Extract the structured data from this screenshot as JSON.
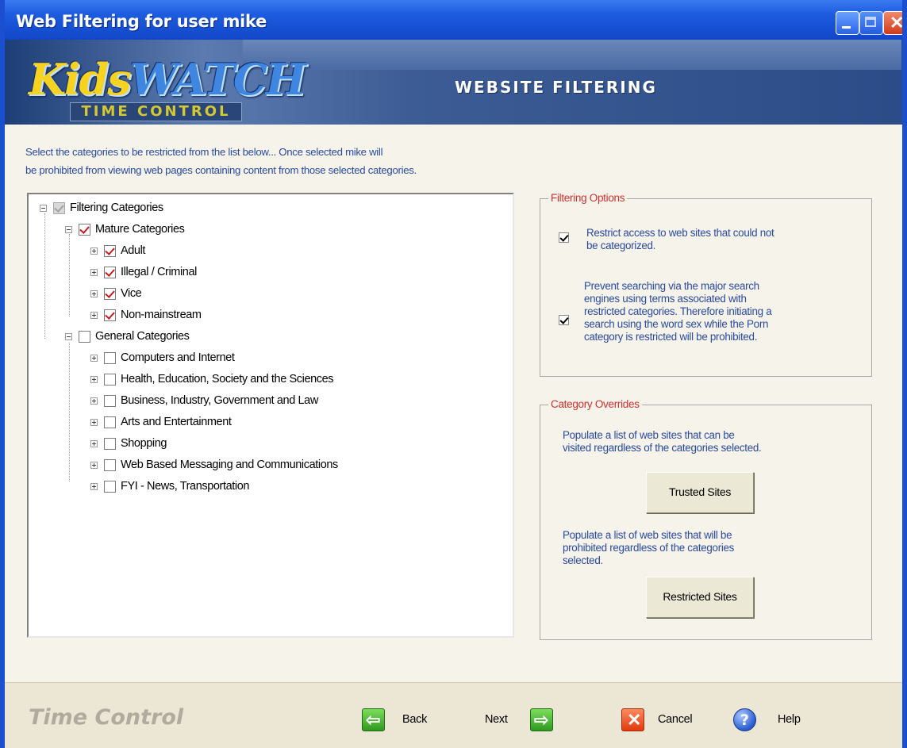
{
  "window": {
    "title": "Web Filtering for user mike"
  },
  "banner": {
    "logo_kids": "Kids",
    "logo_watch": "WATCH",
    "logo_sub": "TIME CONTROL",
    "title": "WEBSITE FILTERING"
  },
  "intro": {
    "line1": "Select the categories to be restricted from the list below... Once selected mike will",
    "line2": "be prohibited from viewing web pages containing content from those selected categories."
  },
  "tree": {
    "root": {
      "label": "Filtering Categories",
      "state": "partial"
    },
    "mature": {
      "label": "Mature Categories",
      "checked": true
    },
    "mature_items": [
      {
        "label": "Adult",
        "checked": true
      },
      {
        "label": "Illegal / Criminal",
        "checked": true
      },
      {
        "label": "Vice",
        "checked": true
      },
      {
        "label": "Non-mainstream",
        "checked": true
      }
    ],
    "general": {
      "label": "General Categories",
      "checked": false
    },
    "general_items": [
      {
        "label": "Computers and Internet",
        "checked": false
      },
      {
        "label": "Health, Education, Society and the Sciences",
        "checked": false
      },
      {
        "label": "Business, Industry, Government and Law",
        "checked": false
      },
      {
        "label": "Arts and Entertainment",
        "checked": false
      },
      {
        "label": "Shopping",
        "checked": false
      },
      {
        "label": "Web Based Messaging and Communications",
        "checked": false
      },
      {
        "label": "FYI - News, Transportation",
        "checked": false
      }
    ]
  },
  "filtering_options": {
    "legend": "Filtering Options",
    "option1": {
      "checked": true,
      "l1": "Restrict access to web sites that could not",
      "l2": "be categorized."
    },
    "option2": {
      "checked": true,
      "l1": "Prevent searching via the major search",
      "l2": "engines using terms associated with",
      "l3": "restricted categories. Therefore initiating a",
      "l4": "search using the word sex while the Porn",
      "l5": "category is restricted will be prohibited."
    }
  },
  "category_overrides": {
    "legend": "Category Overrides",
    "trusted_desc_l1": "Populate a list of web sites that can be",
    "trusted_desc_l2": "visited regardless of the categories selected.",
    "trusted_button": "Trusted Sites",
    "restricted_desc_l1": "Populate a list of web sites that will be",
    "restricted_desc_l2": "prohibited regardless of the categories",
    "restricted_desc_l3": "selected.",
    "restricted_button": "Restricted Sites"
  },
  "footer": {
    "brand": "Time Control",
    "back": "Back",
    "next": "Next",
    "cancel": "Cancel",
    "help": "Help"
  },
  "icons": {
    "back": "left-arrow-icon",
    "next": "right-arrow-icon",
    "cancel": "close-icon",
    "help": "help-icon"
  },
  "colors": {
    "titlebar": "#1d5ce0",
    "legend_text": "#d03030",
    "body_text": "#2a4aa0",
    "check_red": "#c81a1a"
  }
}
